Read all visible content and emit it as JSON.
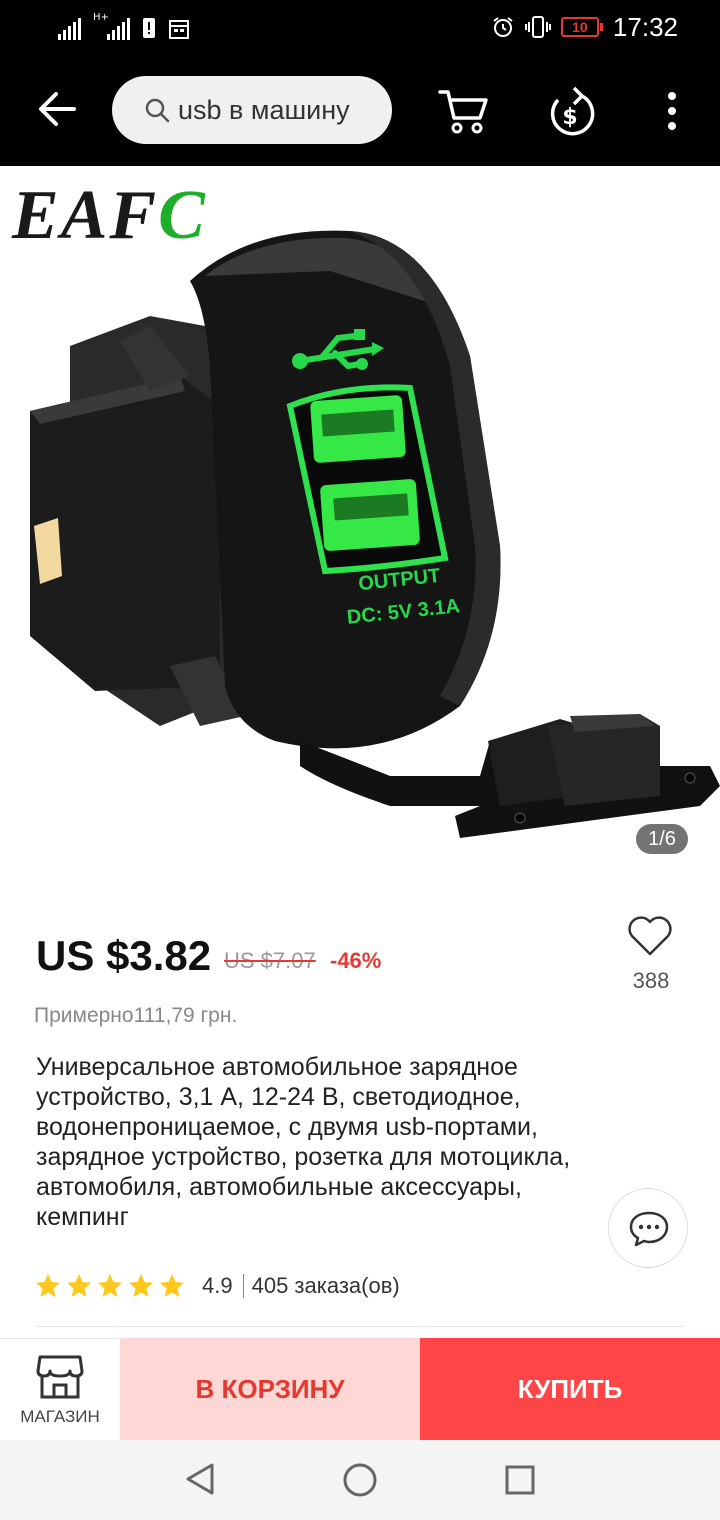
{
  "status_bar": {
    "time": "17:32",
    "battery_level": "10",
    "network": "H+"
  },
  "search": {
    "query": "usb в машину"
  },
  "gallery": {
    "brand_prefix": "EAF",
    "brand_suffix": "C",
    "counter": "1/6",
    "product_label_line1": "OUTPUT",
    "product_label_line2": "DC: 5V 3.1A"
  },
  "product": {
    "price": "US $3.82",
    "old_price": "US $7.07",
    "discount": "-46%",
    "approx_price": "Примерно111,79 грн.",
    "wishlist_count": "388",
    "title": "Универсальное автомобильное зарядное устройство, 3,1 А, 12-24 В, светодиодное, водонепроницаемое, с двумя usb-портами, зарядное устройство, розетка для мотоцикла, автомобиля, автомобильные аксессуары, кемпинг",
    "rating": "4.9",
    "stars": 5,
    "orders": "405 заказа(ов)"
  },
  "actions": {
    "store_label": "МАГАЗИН",
    "add_to_cart": "В КОРЗИНУ",
    "buy_now": "КУПИТЬ"
  },
  "colors": {
    "accent_red": "#ff4545",
    "cart_bg": "#ffd8d5",
    "brand_green": "#1fae2a",
    "star": "#ffc81e"
  }
}
